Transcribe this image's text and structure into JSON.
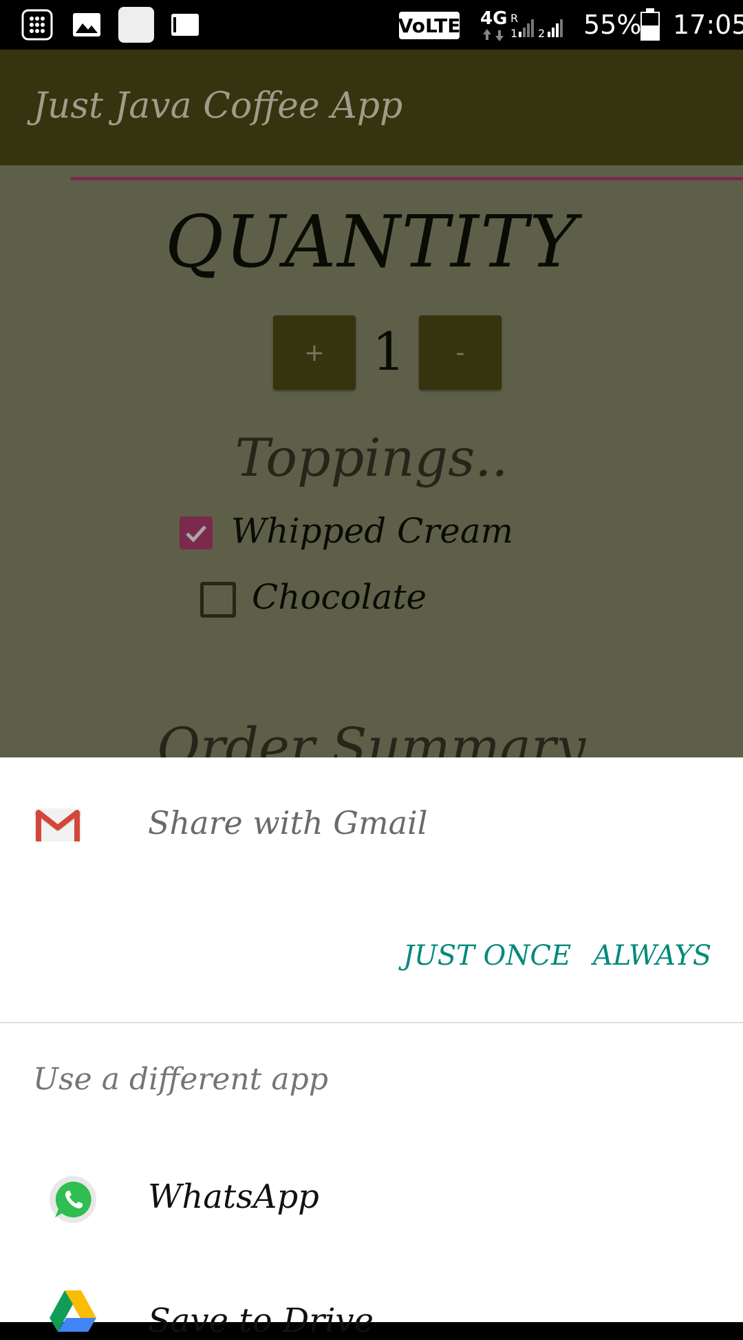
{
  "status_bar": {
    "volte": "VoLTE",
    "network": "4G",
    "battery": "55%",
    "time": "17:05"
  },
  "app_bar": {
    "title": "Just Java Coffee App"
  },
  "content": {
    "quantity_heading": "QUANTITY",
    "increment_label": "+",
    "decrement_label": "-",
    "quantity_value": "1",
    "toppings_heading": "Toppings..",
    "toppings": [
      {
        "label": "Whipped Cream",
        "checked": true
      },
      {
        "label": "Chocolate",
        "checked": false
      }
    ],
    "order_summary_heading": "Order Summary"
  },
  "share_sheet": {
    "title": "Share with Gmail",
    "just_once": "JUST ONCE",
    "always": "ALWAYS",
    "different_app": "Use a different app",
    "apps": [
      {
        "label": "WhatsApp",
        "icon": "whatsapp-icon"
      },
      {
        "label": "Save to Drive",
        "icon": "drive-icon"
      }
    ]
  },
  "colors": {
    "app_bar": "#36330f",
    "accent": "#7b2a4d",
    "button_text": "#00897b"
  }
}
